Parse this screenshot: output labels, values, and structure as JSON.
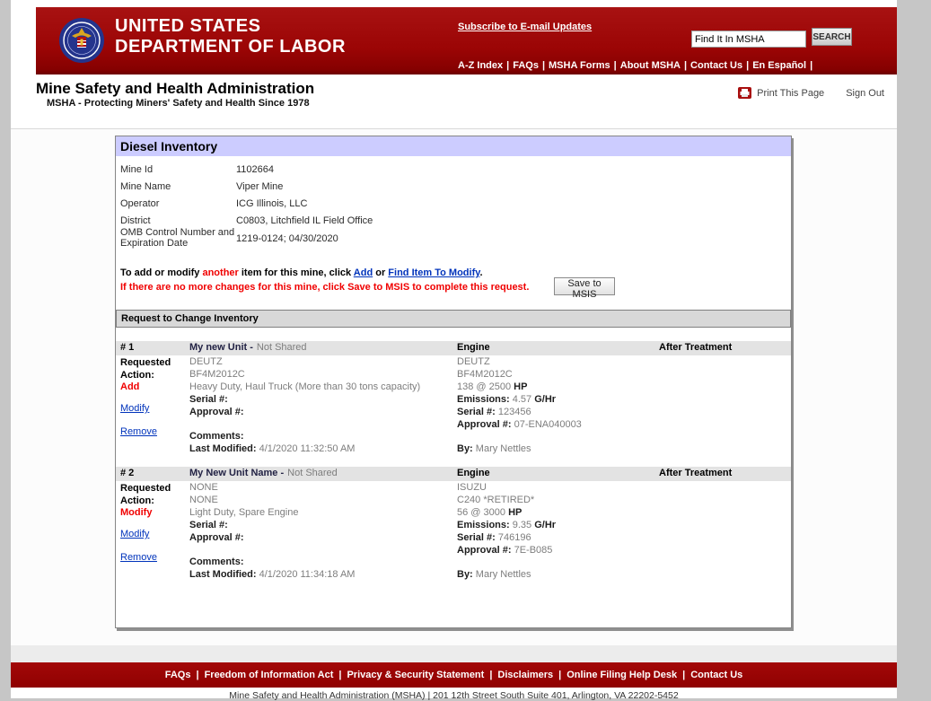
{
  "sep": "|",
  "header": {
    "agency_line1": "UNITED STATES",
    "agency_line2": "DEPARTMENT OF LABOR",
    "subscribe_link": "Subscribe to E-mail Updates",
    "search_value": "Find It In MSHA",
    "search_button": "SEARCH",
    "nav": [
      "A-Z Index",
      "FAQs",
      "MSHA Forms",
      "About MSHA",
      "Contact Us",
      "En Español"
    ]
  },
  "masthead": {
    "title": "Mine Safety and Health Administration",
    "tagline": "MSHA - Protecting Miners' Safety and Health Since 1978",
    "print_link": "Print This Page",
    "signout_link": "Sign Out"
  },
  "panel": {
    "title": "Diesel Inventory",
    "info": [
      {
        "label": "Mine Id",
        "value": "1102664"
      },
      {
        "label": "Mine Name",
        "value": "Viper Mine"
      },
      {
        "label": "Operator",
        "value": "ICG Illinois, LLC"
      },
      {
        "label": "District",
        "value": "C0803, Litchfield IL Field Office"
      },
      {
        "label": "OMB Control Number and Expiration Date",
        "value": "1219-0124; 04/30/2020"
      }
    ],
    "instructions": {
      "line1_a": "To add or modify ",
      "line1_hl": "another",
      "line1_b": " item for this mine, click ",
      "add_link": "Add",
      "line1_c": " or ",
      "find_link": "Find Item To Modify",
      "line1_d": ".",
      "line2": "If there are no more changes for this mine, click Save to MSIS to complete this request.",
      "save_button": "Save to MSIS"
    },
    "section_title": "Request to Change Inventory",
    "columns": {
      "engine": "Engine",
      "after_treatment": "After Treatment"
    },
    "requested_action_label": "Requested Action:",
    "items": [
      {
        "number": "# 1",
        "unit_name": "My new Unit -",
        "shared_status": "Not Shared",
        "action": "Add",
        "modify_link": "Modify",
        "remove_link": "Remove",
        "unit": {
          "make": "DEUTZ",
          "model": "BF4M2012C",
          "type": "Heavy Duty, Haul Truck (More than 30 tons capacity)",
          "serial_label": "Serial #:",
          "serial": "",
          "approval_label": "Approval #:",
          "approval": "",
          "comments_label": "Comments:",
          "comments": "",
          "last_modified_label": "Last Modified:",
          "last_modified": "4/1/2020 11:32:50 AM"
        },
        "engine": {
          "make": "DEUTZ",
          "model": "BF4M2012C",
          "power": "138 @ 2500",
          "power_unit": "HP",
          "emissions_label": "Emissions:",
          "emissions": "4.57",
          "emissions_unit": "G/Hr",
          "serial_label": "Serial #:",
          "serial": "123456",
          "approval_label": "Approval #:",
          "approval": "07-ENA040003",
          "by_label": "By:",
          "by": "Mary Nettles"
        }
      },
      {
        "number": "# 2",
        "unit_name": "My New Unit Name -",
        "shared_status": "Not Shared",
        "action": "Modify",
        "modify_link": "Modify",
        "remove_link": "Remove",
        "unit": {
          "make": "NONE",
          "model": "NONE",
          "type": "Light Duty, Spare Engine",
          "serial_label": "Serial #:",
          "serial": "",
          "approval_label": "Approval #:",
          "approval": "",
          "comments_label": "Comments:",
          "comments": "",
          "last_modified_label": "Last Modified:",
          "last_modified": "4/1/2020 11:34:18 AM"
        },
        "engine": {
          "make": "ISUZU",
          "model": "C240 *RETIRED*",
          "power": "56 @ 3000",
          "power_unit": "HP",
          "emissions_label": "Emissions:",
          "emissions": "9.35",
          "emissions_unit": "G/Hr",
          "serial_label": "Serial #:",
          "serial": "746196",
          "approval_label": "Approval #:",
          "approval": "7E-B085",
          "by_label": "By:",
          "by": "Mary Nettles"
        }
      }
    ]
  },
  "footer": {
    "links": [
      "FAQs",
      "Freedom of Information Act",
      "Privacy & Security Statement",
      "Disclaimers",
      "Online Filing Help Desk",
      "Contact Us"
    ],
    "address": "Mine Safety and Health Administration (MSHA) | 201 12th Street South Suite 401, Arlington, VA 22202-5452"
  }
}
